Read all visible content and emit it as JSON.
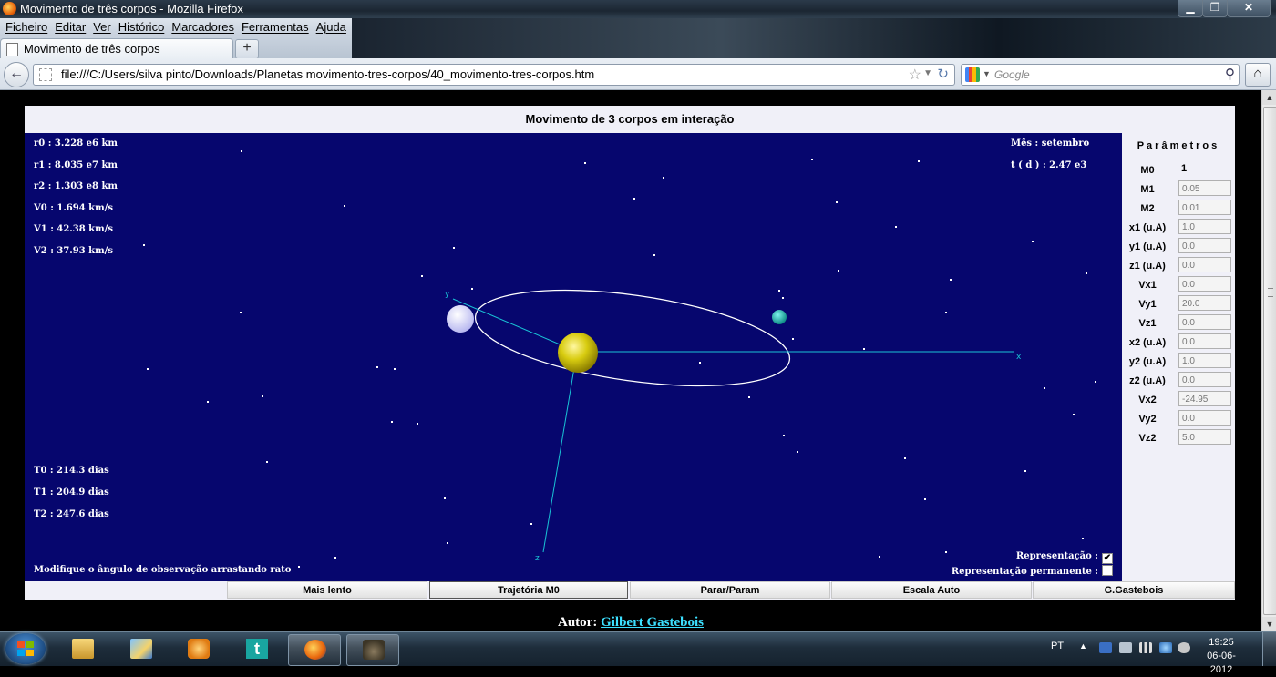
{
  "window": {
    "title": "Movimento de três corpos - Mozilla Firefox",
    "minimize": "▁",
    "maximize": "❐",
    "close": "✕"
  },
  "menu": [
    "Ficheiro",
    "Editar",
    "Ver",
    "Histórico",
    "Marcadores",
    "Ferramentas",
    "Ajuda"
  ],
  "tab": {
    "label": "Movimento de três corpos",
    "new_tab": "+"
  },
  "nav": {
    "url": "file:///C:/Users/silva pinto/Downloads/Planetas movimento-tres-corpos/40_movimento-tres-corpos.htm",
    "search_placeholder": "Google"
  },
  "applet": {
    "title": "Movimento de 3 corpos em interação",
    "readouts_left": [
      "r0 : 3.228 e6 km",
      "r1 : 8.035 e7 km",
      "r2 : 1.303 e8 km",
      "V0 : 1.694 km/s",
      "V1 : 42.38 km/s",
      "V2 : 37.93 km/s"
    ],
    "month": "Mês : setembro",
    "time": "t ( d ) : 2.47 e3",
    "periods": [
      "T0 : 214.3 dias",
      "T1 : 204.9 dias",
      "T2 : 247.6 dias"
    ],
    "hint": "Modifique o ângulo de observação arrastando rato",
    "representacao": {
      "label": "Representação :",
      "checked": true
    },
    "representacao_permanente": {
      "label": "Representação permanente :",
      "checked": false
    },
    "axes": {
      "x": "x",
      "y": "y",
      "z": "z"
    },
    "colors": {
      "background": "#06066e",
      "sun": "#d8cc10",
      "planet1": "#e8e8ff",
      "planet2": "#1ab8b0",
      "axes": "#19c3d6",
      "orbit": "#ffffff"
    }
  },
  "params": {
    "title": "Parâmetros",
    "rows": [
      {
        "label": "M0",
        "value": "1"
      },
      {
        "label": "M1",
        "value": "0.05"
      },
      {
        "label": "M2",
        "value": "0.01"
      },
      {
        "label": "x1 (u.A)",
        "value": "1.0"
      },
      {
        "label": "y1 (u.A)",
        "value": "0.0"
      },
      {
        "label": "z1 (u.A)",
        "value": "0.0"
      },
      {
        "label": "Vx1",
        "value": "0.0"
      },
      {
        "label": "Vy1",
        "value": "20.0"
      },
      {
        "label": "Vz1",
        "value": "0.0"
      },
      {
        "label": "x2 (u.A)",
        "value": "0.0"
      },
      {
        "label": "y2 (u.A)",
        "value": "1.0"
      },
      {
        "label": "z2 (u.A)",
        "value": "0.0"
      },
      {
        "label": "Vx2",
        "value": "-24.95"
      },
      {
        "label": "Vy2",
        "value": "0.0"
      },
      {
        "label": "Vz2",
        "value": "5.0"
      }
    ]
  },
  "buttons": [
    "Mais lento",
    "Trajetória M0",
    "Parar/Param",
    "Escala Auto",
    "G.Gastebois"
  ],
  "author": {
    "prefix": "Autor:",
    "name": "Gilbert Gastebois"
  },
  "taskbar": {
    "lang": "PT",
    "time": "19:25",
    "date": "06-06-2012"
  }
}
